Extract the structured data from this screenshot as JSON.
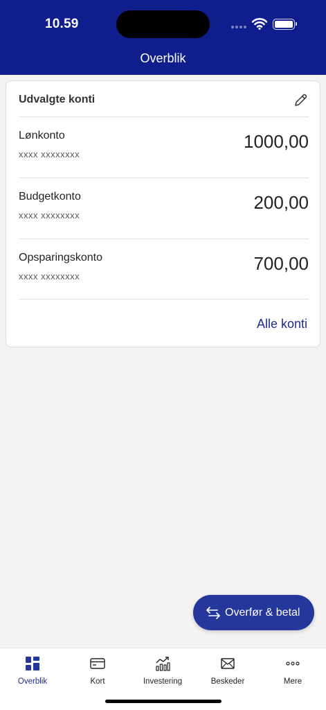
{
  "status": {
    "time": "10.59"
  },
  "header": {
    "title": "Overblik"
  },
  "accounts_card": {
    "title": "Udvalgte konti",
    "accounts": [
      {
        "name": "Lønkonto",
        "number": "xxxx xxxxxxxx",
        "amount": "1000,00"
      },
      {
        "name": "Budgetkonto",
        "number": "xxxx xxxxxxxx",
        "amount": "200,00"
      },
      {
        "name": "Opsparingskonto",
        "number": "xxxx xxxxxxxx",
        "amount": "700,00"
      }
    ],
    "all_link": "Alle konti"
  },
  "fab": {
    "label": "Overfør & betal"
  },
  "tabbar": {
    "items": [
      {
        "label": "Overblik",
        "icon": "grid-icon",
        "active": true
      },
      {
        "label": "Kort",
        "icon": "card-icon"
      },
      {
        "label": "Investering",
        "icon": "chart-icon"
      },
      {
        "label": "Beskeder",
        "icon": "mail-icon"
      },
      {
        "label": "Mere",
        "icon": "more-icon"
      }
    ]
  },
  "colors": {
    "header": "#0f1e8c",
    "accent": "#1e2b8a",
    "fab": "#26379b",
    "background": "#f4f3f1"
  }
}
